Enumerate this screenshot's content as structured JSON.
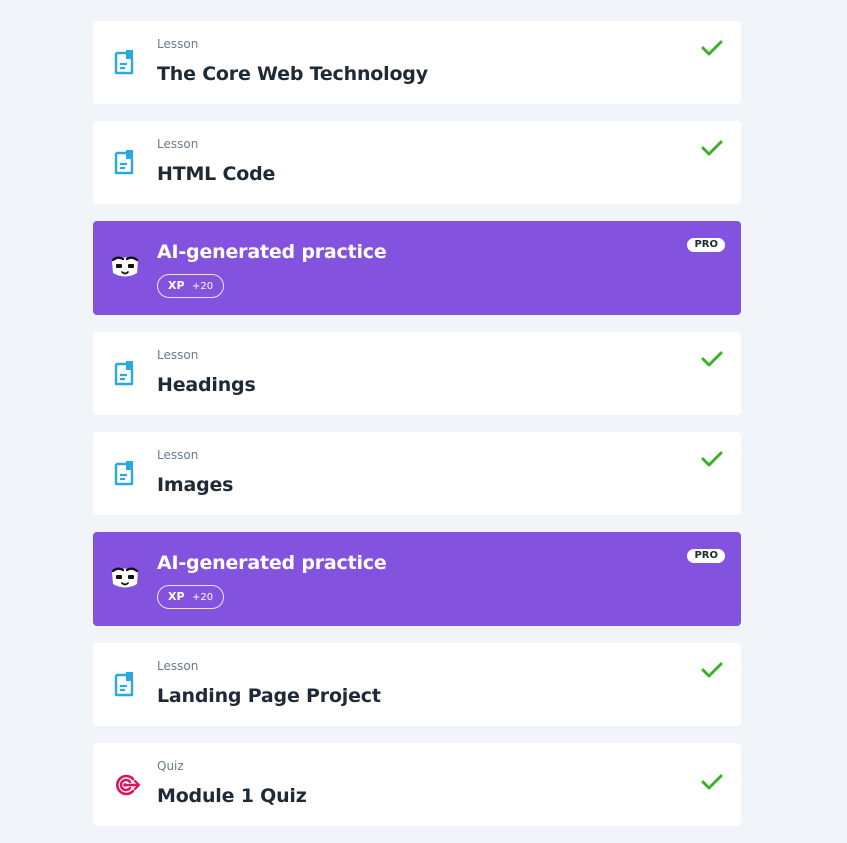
{
  "items": [
    {
      "type": "lesson",
      "kind": "Lesson",
      "title": "The Core Web Technology",
      "completed": true
    },
    {
      "type": "lesson",
      "kind": "Lesson",
      "title": "HTML Code",
      "completed": true
    },
    {
      "type": "practice",
      "title": "AI-generated practice",
      "xp_label": "XP",
      "xp_amount": "+20",
      "pro_label": "PRO"
    },
    {
      "type": "lesson",
      "kind": "Lesson",
      "title": "Headings",
      "completed": true
    },
    {
      "type": "lesson",
      "kind": "Lesson",
      "title": "Images",
      "completed": true
    },
    {
      "type": "practice",
      "title": "AI-generated practice",
      "xp_label": "XP",
      "xp_amount": "+20",
      "pro_label": "PRO"
    },
    {
      "type": "lesson",
      "kind": "Lesson",
      "title": "Landing Page Project",
      "completed": true
    },
    {
      "type": "quiz",
      "kind": "Quiz",
      "title": "Module 1 Quiz",
      "completed": true
    }
  ],
  "colors": {
    "background": "#f1f4f8",
    "card": "#ffffff",
    "practice": "#8352de",
    "lesson_icon": "#29a9e1",
    "quiz_icon": "#e0115f",
    "check": "#3fae29",
    "title": "#1f2a37",
    "kind": "#6b7b8c"
  },
  "icons": {
    "lesson": "lesson-document-icon",
    "practice": "ai-practice-face-icon",
    "quiz": "quiz-target-icon",
    "completed": "checkmark-icon"
  }
}
